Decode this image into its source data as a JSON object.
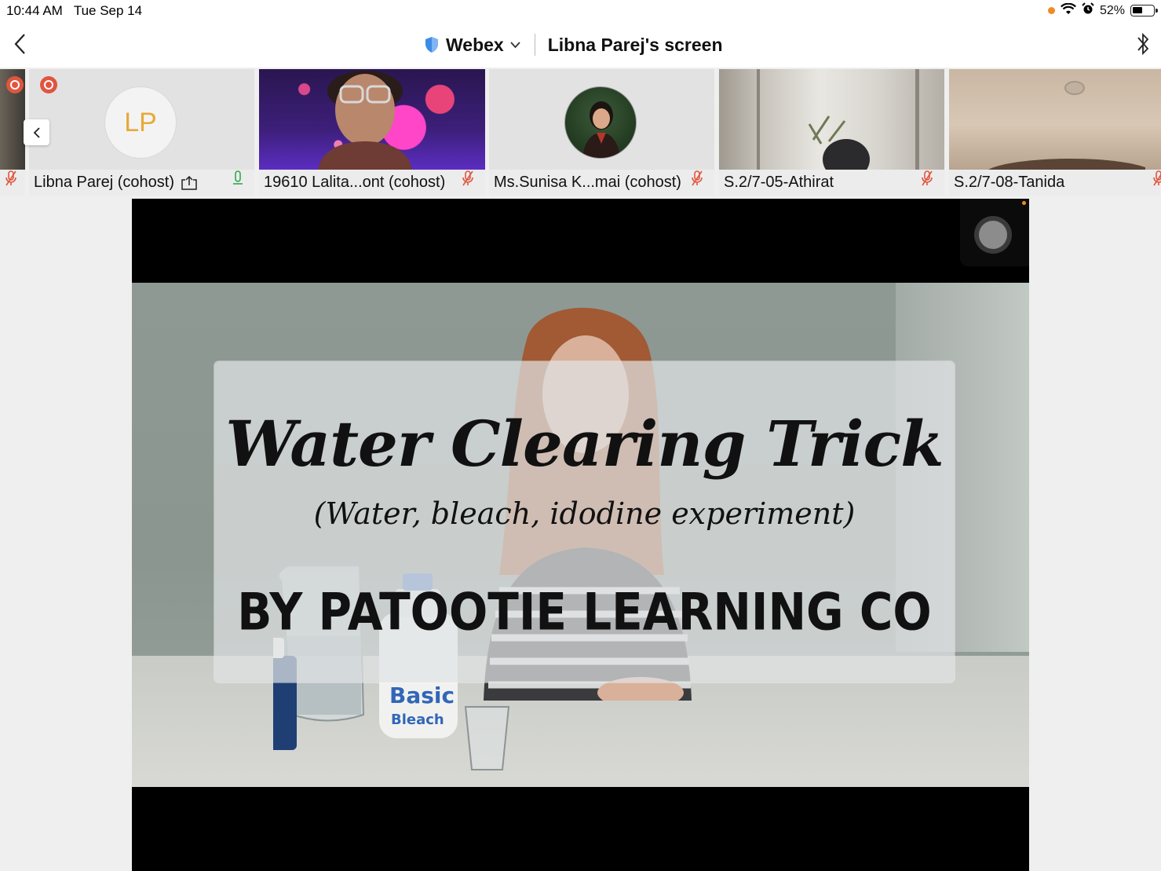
{
  "status_bar": {
    "time": "10:44 AM",
    "date": "Tue Sep 14",
    "battery": "52%",
    "battery_level": 0.52
  },
  "nav": {
    "app_name": "Webex",
    "screen_title": "Libna Parej's screen"
  },
  "participants": [
    {
      "name": "Libna Parej (cohost)",
      "initials": "LP",
      "mic": "on",
      "sharing": true
    },
    {
      "name": "19610 Lalita...ont (cohost)",
      "mic": "muted"
    },
    {
      "name": "Ms.Sunisa K...mai (cohost)",
      "mic": "muted"
    },
    {
      "name": "S.2/7-05-Athirat",
      "mic": "muted"
    },
    {
      "name": "S.2/7-08-Tanida",
      "mic": "muted"
    }
  ],
  "shared_content": {
    "title": "Water Clearing Trick",
    "subtitle": "(Water, bleach, idodine experiment)",
    "byline": "BY PATOOTIE LEARNING CO",
    "bottle_label_1": "Basic",
    "bottle_label_2": "Bleach"
  },
  "colors": {
    "accent_orange": "#e0553f",
    "avatar_initials": "#e8a93a",
    "mic_muted": "#e0553f",
    "mic_active": "#2fa84f",
    "webex_shield": "#3c8ce7"
  }
}
